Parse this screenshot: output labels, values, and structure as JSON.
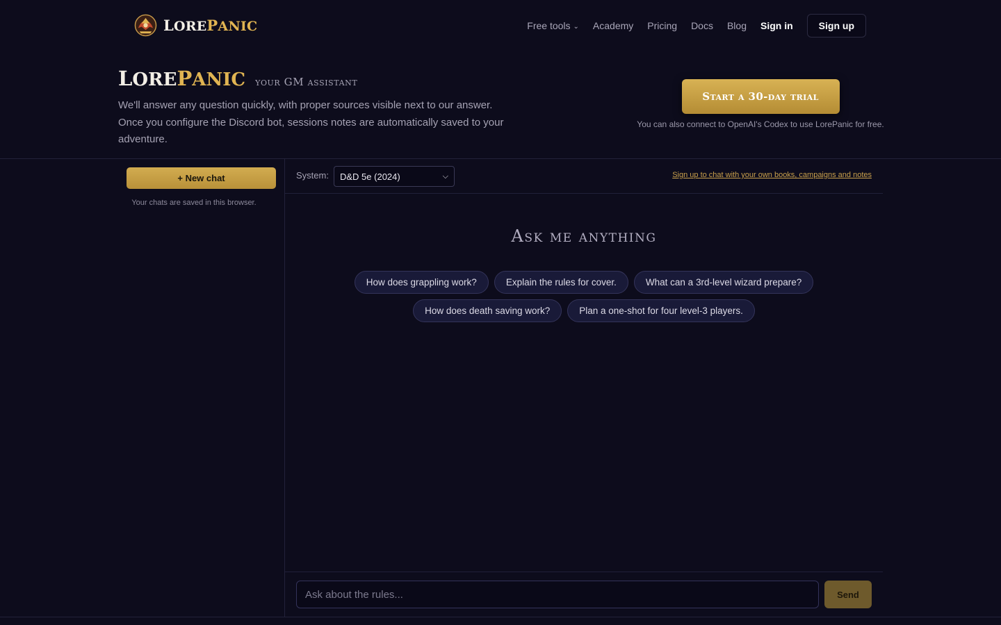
{
  "brand": {
    "lead": "L",
    "part1": "ORE",
    "lead2": "P",
    "part2": "ANIC"
  },
  "nav": {
    "free_tools": "Free tools",
    "academy": "Academy",
    "pricing": "Pricing",
    "docs": "Docs",
    "blog": "Blog",
    "sign_in": "Sign in",
    "sign_up": "Sign up"
  },
  "hero": {
    "tagline": "your GM assistant",
    "description": "We'll answer any question quickly, with proper sources visible next to our answer. Once you configure the Discord bot, sessions notes are automatically saved to your adventure.",
    "cta_label": "Start a 30-day trial",
    "cta_note": "You can also connect to OpenAI's Codex to use LorePanic for free."
  },
  "sidebar": {
    "new_chat_label": "+ New chat",
    "saved_note": "Your chats are saved in this browser."
  },
  "chat": {
    "system_label": "System:",
    "system_value": "D&D 5e (2024)",
    "signup_link": "Sign up to chat with your own books, campaigns and notes",
    "heading": "Ask me anything",
    "suggestions_row1": [
      "How does grappling work?",
      "Explain the rules for cover.",
      "What can a 3rd-level wizard prepare?"
    ],
    "suggestions_row2": [
      "How does death saving work?",
      "Plan a one-shot for four level-3 players."
    ],
    "input_placeholder": "Ask about the rules...",
    "send_label": "Send"
  },
  "colors": {
    "background": "#0d0c1c",
    "gold": "#e0b452",
    "chip_bg": "#191a38"
  },
  "icons": {
    "logo": "dragon-crest-icon",
    "dropdown": "chevron-down-icon"
  }
}
